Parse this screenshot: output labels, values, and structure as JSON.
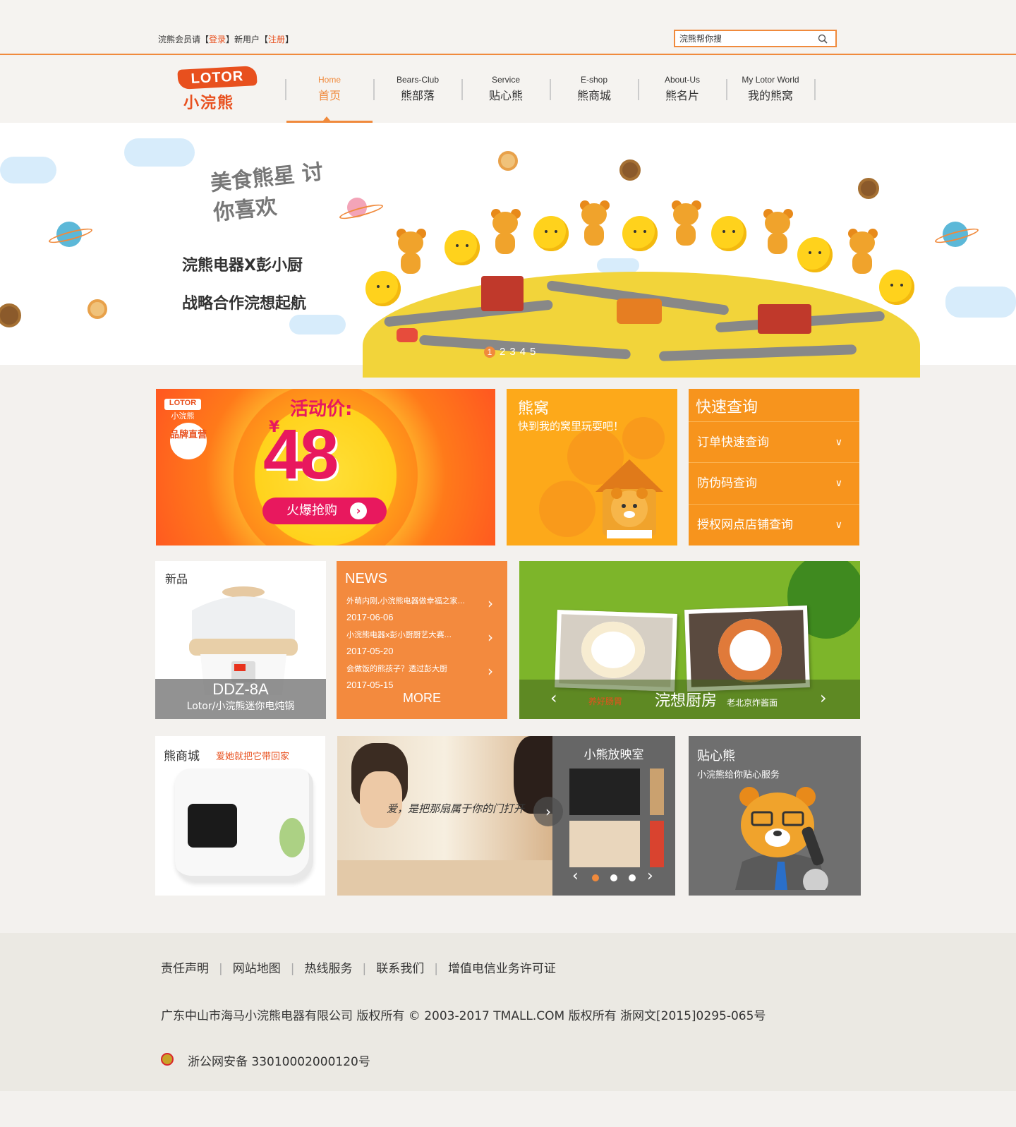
{
  "topbar": {
    "login_prefix": "浣熊会员请【",
    "login_link": "登录",
    "middle": "】新用户【",
    "register_link": "注册",
    "suffix": "】",
    "search_value": "浣熊帮你搜"
  },
  "logo": {
    "brand": "LOTOR",
    "sub": "小浣熊"
  },
  "nav": [
    {
      "en": "Home",
      "cn": "首页"
    },
    {
      "en": "Bears-Club",
      "cn": "熊部落"
    },
    {
      "en": "Service",
      "cn": "贴心熊"
    },
    {
      "en": "E-shop",
      "cn": "熊商城"
    },
    {
      "en": "About-Us",
      "cn": "熊名片"
    },
    {
      "en": "My Lotor World",
      "cn": "我的熊窝"
    }
  ],
  "banner": {
    "slogan": "美食熊星 讨你喜欢",
    "line1": "浣熊电器X彭小厨",
    "line2": "战略合作浣想起航",
    "dots": [
      "1",
      "2",
      "3",
      "4",
      "5"
    ]
  },
  "promo": {
    "logo_brand": "LOTOR",
    "logo_sub": "小浣熊",
    "badge": "品牌直营",
    "title": "活动价:",
    "currency": "¥",
    "price": "48",
    "button": "火爆抢购"
  },
  "den": {
    "title": "熊窝",
    "subtitle": "快到我的窝里玩耍吧！"
  },
  "quick": {
    "title": "快速查询",
    "items": [
      "订单快速查询",
      "防伪码查询",
      "授权网点店铺查询"
    ]
  },
  "newprod": {
    "label": "新品",
    "model": "DDZ-8A",
    "name": "Lotor/小浣熊迷你电炖锅"
  },
  "news": {
    "title": "NEWS",
    "items": [
      {
        "title": "外萌内刚,小浣熊电器做幸福之家...",
        "date": "2017-06-06"
      },
      {
        "title": "小浣熊电器x彭小厨厨艺大赛...",
        "date": "2017-05-20"
      },
      {
        "title": "会做饭的熊孩子？透过彭大厨",
        "date": "2017-05-15"
      }
    ],
    "more": "MORE"
  },
  "kitchen": {
    "tag": "养好肠胃",
    "title": "浣想厨房",
    "subtitle": "老北京炸酱面"
  },
  "mall": {
    "title": "熊商城",
    "subtitle": "爱她就把它带回家"
  },
  "video": {
    "quote": "爱，是把那扇属于你的门打开",
    "title": "小熊放映室"
  },
  "care": {
    "title": "贴心熊",
    "subtitle": "小浣熊给你贴心服务"
  },
  "footer": {
    "links": [
      "责任声明",
      "网站地图",
      "热线服务",
      "联系我们",
      "增值电信业务许可证"
    ],
    "copyright": "广东中山市海马小浣熊电器有限公司 版权所有  © 2003-2017 TMALL.COM 版权所有  浙网文[2015]0295-065号",
    "police": "浙公网安备 33010002000120号"
  },
  "colors": {
    "accent": "#f08a3c",
    "orange": "#f7941d",
    "red": "#e8501e",
    "pink": "#e8185e",
    "green": "#7db52a"
  }
}
